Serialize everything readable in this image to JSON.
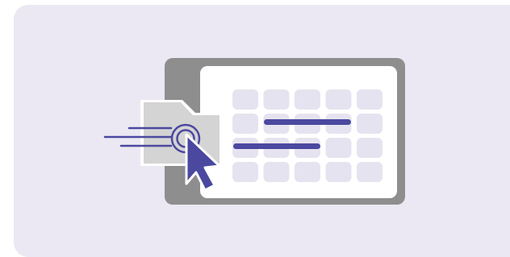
{
  "illustration": {
    "name": "drag-file-to-calendar-illustration",
    "icons": [
      "calendar-icon",
      "file-icon",
      "cursor-arrow-icon",
      "click-ripple-icon",
      "motion-lines-icon"
    ],
    "grid": {
      "rows": 4,
      "columns": 5
    },
    "colors": {
      "background": "#ebe8f3",
      "frame": "#8e8e8e",
      "panel": "#ffffff",
      "cell": "#e6e3f0",
      "accent": "#4b48a0",
      "file": "#d4d4d4"
    }
  }
}
